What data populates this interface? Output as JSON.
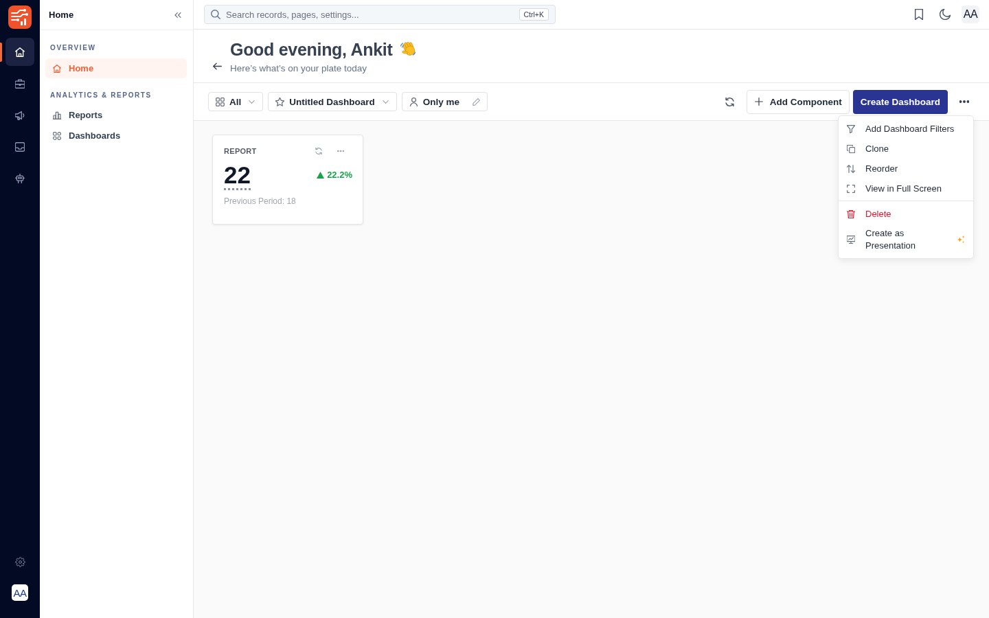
{
  "rail": {
    "items": [
      {
        "kind": "home",
        "selected": true
      },
      {
        "kind": "briefcase",
        "selected": false
      },
      {
        "kind": "megaphone",
        "selected": false
      },
      {
        "kind": "inbox",
        "selected": false
      },
      {
        "kind": "robot",
        "selected": false
      }
    ],
    "avatar": "AA"
  },
  "sidebar": {
    "title": "Home",
    "sections": [
      {
        "heading": "OVERVIEW",
        "items": [
          {
            "kind": "home",
            "label": "Home",
            "selected": true
          }
        ]
      },
      {
        "heading": "ANALYTICS & REPORTS",
        "items": [
          {
            "kind": "reports",
            "label": "Reports",
            "selected": false
          },
          {
            "kind": "dashboards",
            "label": "Dashboards",
            "selected": false
          }
        ]
      }
    ]
  },
  "topbar": {
    "search": {
      "placeholder": "Search records, pages, settings...",
      "shortcut": "Ctrl+K"
    },
    "avatar": "AA"
  },
  "header": {
    "title": "Good evening, Ankit",
    "subtitle": "Here’s what’s on your plate today"
  },
  "toolbar": {
    "filters": [
      {
        "kind": "view",
        "label": "All"
      },
      {
        "kind": "dashboard",
        "label": "Untitled Dashboard"
      },
      {
        "kind": "sharing",
        "label": "Only me"
      }
    ],
    "add_button": "Add Component",
    "create_button": "Create Dashboard"
  },
  "menu": {
    "groups": [
      [
        {
          "kind": "filter",
          "label": "Add Dashboard Filters",
          "danger": false,
          "ai": false
        },
        {
          "kind": "clone",
          "label": "Clone",
          "danger": false,
          "ai": false
        },
        {
          "kind": "reorder",
          "label": "Reorder",
          "danger": false,
          "ai": false
        },
        {
          "kind": "fullscreen",
          "label": "View in Full Screen",
          "danger": false,
          "ai": false
        }
      ],
      [
        {
          "kind": "delete",
          "label": "Delete",
          "danger": true,
          "ai": false
        },
        {
          "kind": "presentation",
          "label": "Create as Presentation",
          "danger": false,
          "ai": true
        }
      ]
    ]
  },
  "cards": [
    {
      "title": "REPORT",
      "value": "22",
      "rising": true,
      "change": "22.2%",
      "previous": "Previous Period: 18"
    }
  ]
}
